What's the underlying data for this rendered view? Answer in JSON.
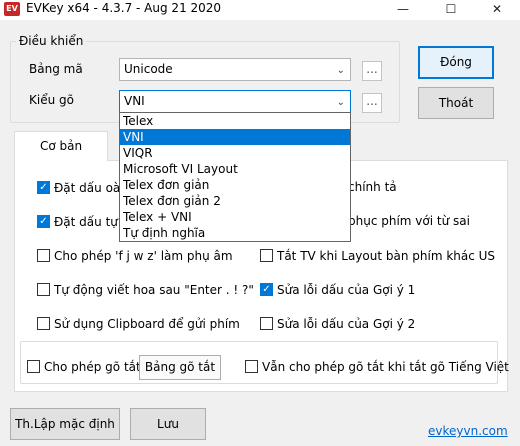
{
  "window": {
    "title": "EVKey x64 - 4.3.7 - Aug 21 2020",
    "app_icon_text": "EV",
    "minimize": "—",
    "maximize": "☐",
    "close": "✕"
  },
  "control_group": {
    "legend": "Điều khiển",
    "encoding_label": "Bảng mã",
    "encoding_value": "Unicode",
    "input_label": "Kiểu gõ",
    "input_value": "VNI",
    "more": "..."
  },
  "buttons": {
    "close": "Đóng",
    "exit": "Thoát",
    "reset": "Th.Lập mặc định",
    "save": "Lưu",
    "shortcut_table": "Bảng gõ tắt"
  },
  "tabs": {
    "basic": "Cơ bản"
  },
  "dropdown": {
    "items": [
      "Telex",
      "VNI",
      "VIQR",
      "Microsoft VI Layout",
      "Telex đơn giản",
      "Telex đơn giản 2",
      "Telex + VNI",
      "Tự định nghĩa"
    ],
    "selected_index": 1
  },
  "options": {
    "tone_mark": "Đặt dấu oà,",
    "tone_mark_right": "chính tả",
    "auto_tone": "Đặt dấu tự",
    "auto_tone_right": "phục phím với từ sai",
    "fjwz": "Cho phép 'f j w z' làm phụ âm",
    "disable_non_us": "Tắt TV khi Layout bàn phím khác US",
    "auto_caps": "Tự động viết hoa sau \"Enter . ! ?\"",
    "fix_suggest_1": "Sửa lỗi dấu của Gợi ý 1",
    "clipboard": "Sử dụng Clipboard để gửi phím",
    "fix_suggest_2": "Sửa lỗi dấu của Gợi ý 2",
    "allow_shortcut": "Cho phép gõ tắt",
    "shortcut_when_off": "Vẫn cho phép gõ tắt khi tắt gõ Tiếng Việt",
    "check_mark": "✓"
  },
  "footer": {
    "website": "evkeyvn.com"
  }
}
